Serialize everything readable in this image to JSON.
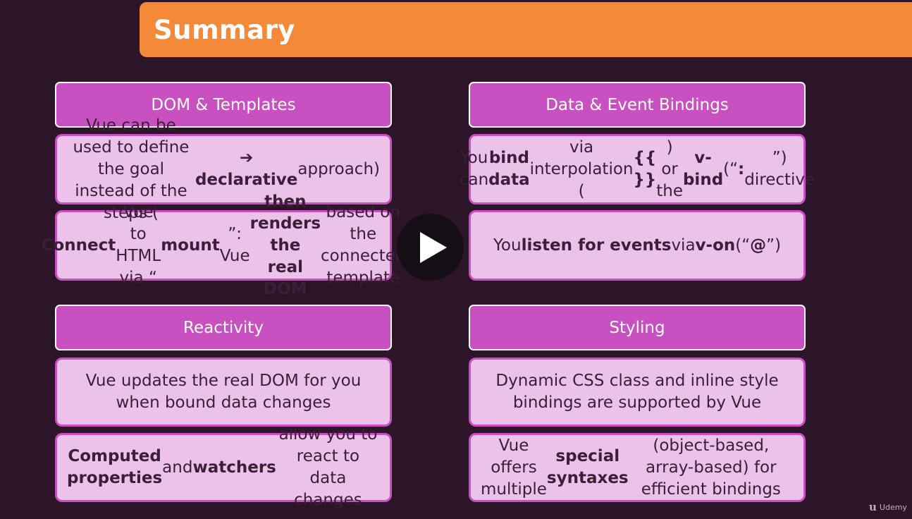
{
  "banner": {
    "title": "Summary"
  },
  "sections": {
    "dom_templates": {
      "heading": "DOM & Templates",
      "box1": "Vue can be used to define the goal instead of the steps (<b>➔ declarative</b> approach)",
      "box2": "<b>Connect</b> Vue to HTML via “<b>mount</b>”: Vue <b>then renders the real DOM</b> based on the connected template"
    },
    "data_bindings": {
      "heading": "Data & Event Bindings",
      "box1": "You can <b>bind data</b> via interpolation (<b>{{ }}</b>) or the <b>v-bind</b> (“<b>:</b>”) directive",
      "box2": "You <b>listen for events</b> via <b>v-on</b> (“<b>@</b>”)"
    },
    "reactivity": {
      "heading": "Reactivity",
      "box1": "Vue updates the real DOM for you when bound data changes",
      "box2": "<b>Computed properties</b> and <b>watchers</b> allow you to react to data changes"
    },
    "styling": {
      "heading": "Styling",
      "box1": "Dynamic CSS class and inline style bindings are supported by Vue",
      "box2": "Vue offers multiple <b>special syntaxes</b> (object-based, array-based) for efficient bindings"
    }
  },
  "video": {
    "play_icon": "play-icon"
  },
  "watermark": {
    "mark": "u",
    "text": "Udemy"
  }
}
